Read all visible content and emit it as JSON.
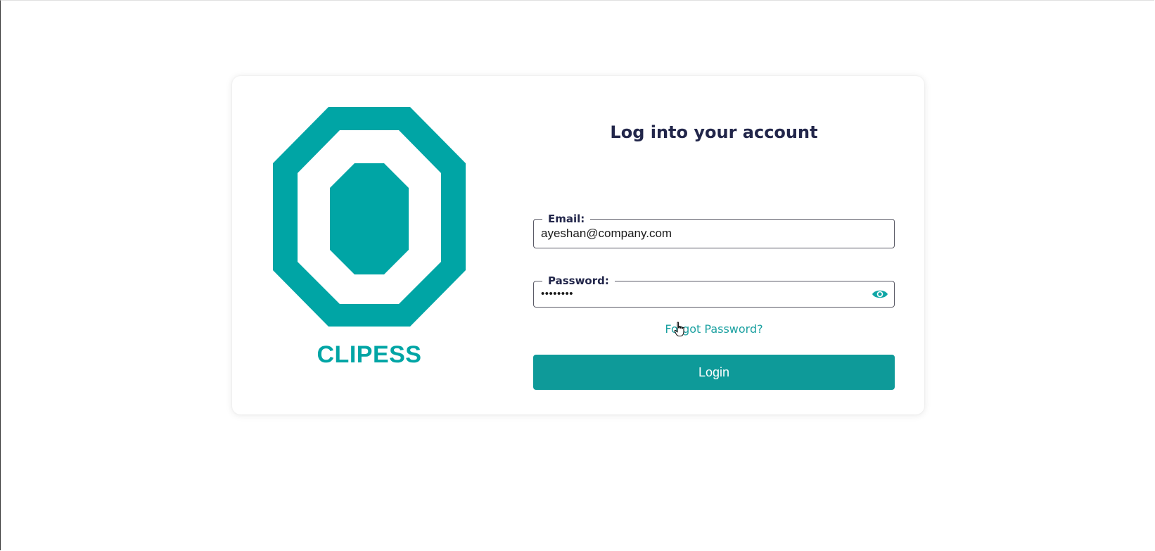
{
  "brand": {
    "name": "CLIPESS",
    "accent_color": "#00a5a5"
  },
  "login": {
    "title": "Log into your account",
    "email": {
      "label": "Email:",
      "value": "ayeshan@company.com"
    },
    "password": {
      "label": "Password:",
      "value": "••••••••",
      "toggle_icon": "eye-icon"
    },
    "forgot_label": "Forgot Password?",
    "login_label": "Login",
    "button_color": "#0e9a99"
  }
}
